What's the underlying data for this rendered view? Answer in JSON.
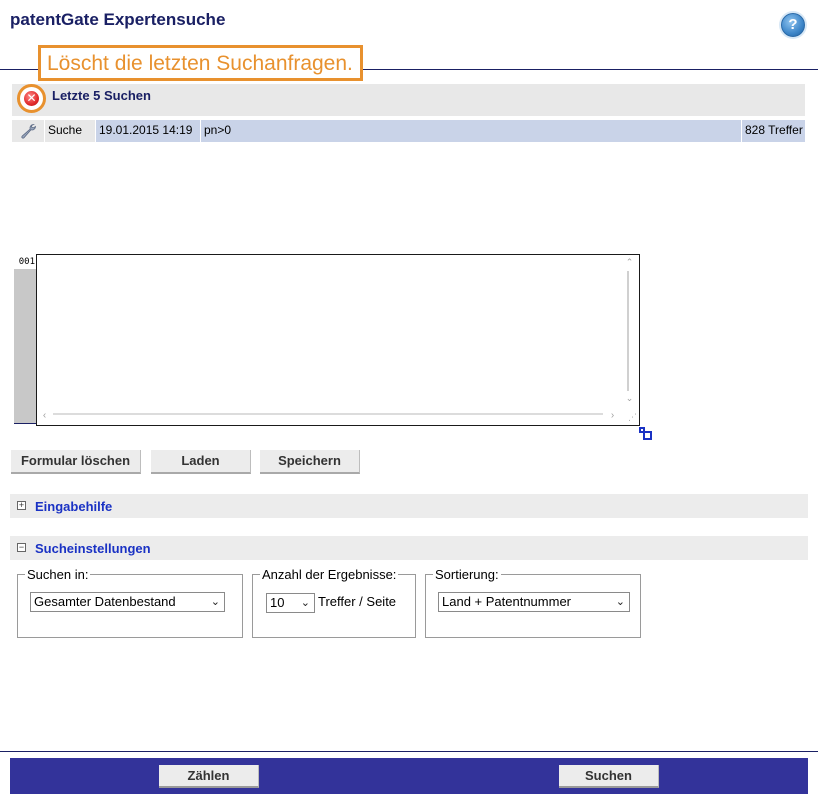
{
  "header": {
    "title": "patentGate Expertensuche",
    "help_icon": "help-icon"
  },
  "tooltip": {
    "text": "Löscht die letzten Suchanfragen."
  },
  "recent": {
    "title": "Letzte 5 Suchen",
    "rows": [
      {
        "name": "Suche",
        "date": "19.01.2015 14:19",
        "query": "pn>0",
        "hits": "828 Treffer"
      }
    ]
  },
  "editor": {
    "line_number": "001",
    "value": ""
  },
  "buttons": {
    "clear": "Formular löschen",
    "load": "Laden",
    "save": "Speichern"
  },
  "sections": {
    "help": {
      "label": "Eingabehilfe",
      "toggle": "⊞"
    },
    "settings": {
      "label": "Sucheinstellungen",
      "toggle": "⊟"
    }
  },
  "settings": {
    "search_in": {
      "legend": "Suchen in:",
      "value": "Gesamter Datenbestand"
    },
    "results": {
      "legend": "Anzahl der Ergebnisse:",
      "value": "10",
      "suffix": "Treffer / Seite"
    },
    "sort": {
      "legend": "Sortierung:",
      "value": "Land + Patentnummer"
    }
  },
  "footer": {
    "count": "Zählen",
    "search": "Suchen"
  },
  "colors": {
    "accent": "#e8912e",
    "navy": "#1a2064",
    "footer": "#33339a",
    "link": "#1a32c4",
    "row_highlight": "#c9d3e8"
  }
}
